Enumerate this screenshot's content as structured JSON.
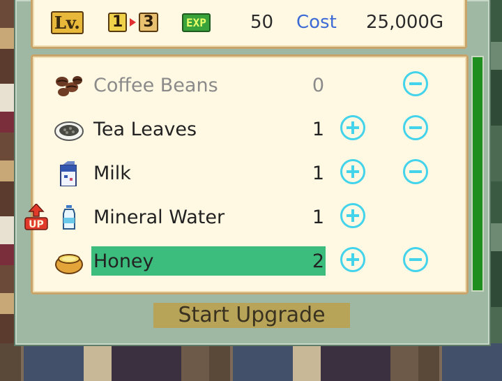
{
  "header": {
    "level_label": "Lv.",
    "level_from": "1",
    "level_to": "3",
    "exp_label": "EXP",
    "exp_value": "50",
    "cost_label": "Cost",
    "cost_value": "25,000G"
  },
  "items": [
    {
      "name": "Coffee Beans",
      "count": "0",
      "icon": "coffee-beans-icon",
      "disabled": true,
      "plus": false,
      "minus": true
    },
    {
      "name": "Tea Leaves",
      "count": "1",
      "icon": "tea-leaves-icon",
      "disabled": false,
      "plus": true,
      "minus": true
    },
    {
      "name": "Milk",
      "count": "1",
      "icon": "milk-carton-icon",
      "disabled": false,
      "plus": true,
      "minus": true
    },
    {
      "name": "Mineral Water",
      "count": "1",
      "icon": "water-bottle-icon",
      "disabled": false,
      "plus": true,
      "minus": false,
      "badge": "UP"
    },
    {
      "name": "Honey",
      "count": "2",
      "icon": "honey-pot-icon",
      "disabled": false,
      "plus": true,
      "minus": true,
      "selected": true
    }
  ],
  "start_button_label": "Start Upgrade",
  "colors": {
    "accent_blue": "#3d6bd6",
    "button_cyan": "#43d3ea",
    "selected_row": "#3dbd7d",
    "scrollbar": "#1e8f1e"
  }
}
